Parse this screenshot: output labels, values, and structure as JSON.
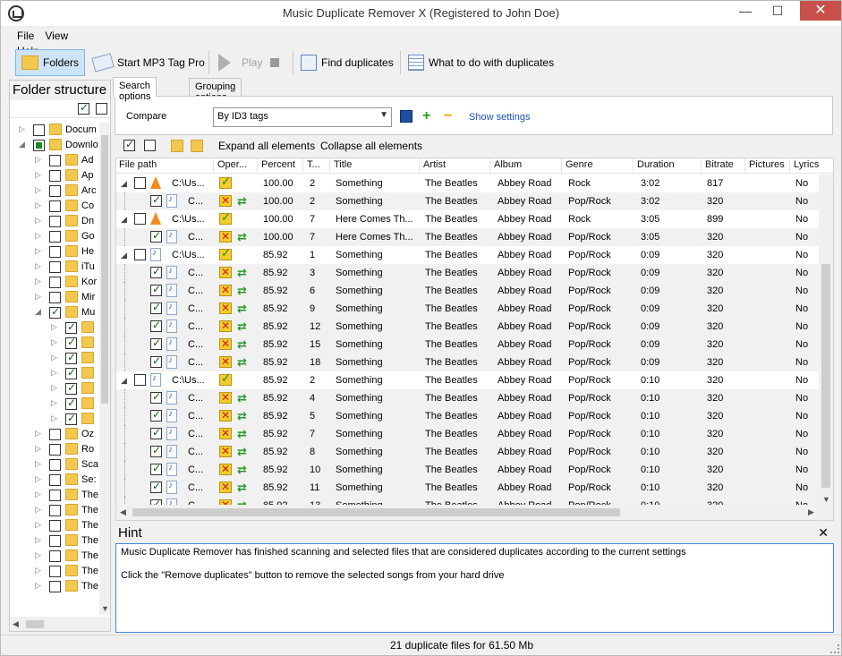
{
  "window": {
    "title": "Music Duplicate Remover X (Registered to John Doe)",
    "minimize": "—",
    "maximize": "☐",
    "close": "✕"
  },
  "menu": [
    "File",
    "View",
    "Help"
  ],
  "toolbar": {
    "folders": "Folders",
    "mp3tag": "Start MP3 Tag Pro",
    "play": "Play",
    "find": "Find duplicates",
    "what": "What to do with duplicates"
  },
  "left": {
    "title": "Folder structure",
    "tree": [
      {
        "label": "Docum",
        "level": 0,
        "arrow": "▷",
        "check": "off"
      },
      {
        "label": "Downlo",
        "level": 0,
        "arrow": "◢",
        "check": "partial"
      },
      {
        "label": "Ad",
        "level": 1,
        "arrow": "▷",
        "check": "off"
      },
      {
        "label": "Ap",
        "level": 1,
        "arrow": "▷",
        "check": "off"
      },
      {
        "label": "Arc",
        "level": 1,
        "arrow": "▷",
        "check": "off"
      },
      {
        "label": "Co",
        "level": 1,
        "arrow": "▷",
        "check": "off"
      },
      {
        "label": "Dn",
        "level": 1,
        "arrow": "▷",
        "check": "off"
      },
      {
        "label": "Go",
        "level": 1,
        "arrow": "▷",
        "check": "off"
      },
      {
        "label": "He",
        "level": 1,
        "arrow": "▷",
        "check": "off"
      },
      {
        "label": "iTu",
        "level": 1,
        "arrow": "▷",
        "check": "off"
      },
      {
        "label": "Kor",
        "level": 1,
        "arrow": "▷",
        "check": "off"
      },
      {
        "label": "Mir",
        "level": 1,
        "arrow": "▷",
        "check": "off"
      },
      {
        "label": "Mu",
        "level": 1,
        "arrow": "◢",
        "check": "on"
      },
      {
        "label": "",
        "level": 2,
        "arrow": "▷",
        "check": "on"
      },
      {
        "label": "",
        "level": 2,
        "arrow": "▷",
        "check": "on"
      },
      {
        "label": "",
        "level": 2,
        "arrow": "▷",
        "check": "on"
      },
      {
        "label": "",
        "level": 2,
        "arrow": "▷",
        "check": "on"
      },
      {
        "label": "",
        "level": 2,
        "arrow": "▷",
        "check": "on"
      },
      {
        "label": "",
        "level": 2,
        "arrow": "▷",
        "check": "on"
      },
      {
        "label": "",
        "level": 2,
        "arrow": "▷",
        "check": "on"
      },
      {
        "label": "Oz",
        "level": 1,
        "arrow": "▷",
        "check": "off"
      },
      {
        "label": "Ro",
        "level": 1,
        "arrow": "▷",
        "check": "off"
      },
      {
        "label": "Sca",
        "level": 1,
        "arrow": "▷",
        "check": "off"
      },
      {
        "label": "Se:",
        "level": 1,
        "arrow": "▷",
        "check": "off"
      },
      {
        "label": "The",
        "level": 1,
        "arrow": "▷",
        "check": "off"
      },
      {
        "label": "The",
        "level": 1,
        "arrow": "▷",
        "check": "off"
      },
      {
        "label": "The",
        "level": 1,
        "arrow": "▷",
        "check": "off"
      },
      {
        "label": "The",
        "level": 1,
        "arrow": "▷",
        "check": "off"
      },
      {
        "label": "The",
        "level": 1,
        "arrow": "▷",
        "check": "off"
      },
      {
        "label": "The",
        "level": 1,
        "arrow": "▷",
        "check": "off"
      },
      {
        "label": "The",
        "level": 1,
        "arrow": "▷",
        "check": "off"
      }
    ]
  },
  "tabs": [
    "Search options",
    "Grouping options"
  ],
  "search": {
    "compare_label": "Compare",
    "compare_value": "By ID3 tags",
    "show_settings": "Show settings"
  },
  "grid_toolbar": {
    "expand": "Expand all elements",
    "collapse": "Collapse all elements"
  },
  "columns": [
    "File path",
    "Oper...",
    "Percent",
    "T...",
    "Title",
    "Artist",
    "Album",
    "Genre",
    "Duration",
    "Bitrate",
    "Pictures",
    "Lyrics"
  ],
  "rows": [
    {
      "kind": "parent",
      "icon": "vlc",
      "path": "C:\\Us...",
      "op": "ok",
      "percent": "100.00",
      "track": "2",
      "title": "Something",
      "artist": "The Beatles",
      "album": "Abbey Road",
      "genre": "Rock",
      "duration": "3:02",
      "bitrate": "817",
      "lyrics": "No"
    },
    {
      "kind": "child",
      "icon": "file",
      "path": "C...",
      "op": "del",
      "percent": "100.00",
      "track": "2",
      "title": "Something",
      "artist": "The Beatles",
      "album": "Abbey Road",
      "genre": "Pop/Rock",
      "duration": "3:02",
      "bitrate": "320",
      "lyrics": "No"
    },
    {
      "kind": "parent",
      "icon": "vlc",
      "path": "C:\\Us...",
      "op": "ok",
      "percent": "100.00",
      "track": "7",
      "title": "Here Comes Th...",
      "artist": "The Beatles",
      "album": "Abbey Road",
      "genre": "Rock",
      "duration": "3:05",
      "bitrate": "899",
      "lyrics": "No"
    },
    {
      "kind": "child",
      "icon": "file",
      "path": "C...",
      "op": "del",
      "percent": "100.00",
      "track": "7",
      "title": "Here Comes Th...",
      "artist": "The Beatles",
      "album": "Abbey Road",
      "genre": "Pop/Rock",
      "duration": "3:05",
      "bitrate": "320",
      "lyrics": "No"
    },
    {
      "kind": "parent",
      "icon": "file",
      "path": "C:\\Us...",
      "op": "ok",
      "percent": "85.92",
      "track": "1",
      "title": "Something",
      "artist": "The Beatles",
      "album": "Abbey Road",
      "genre": "Pop/Rock",
      "duration": "0:09",
      "bitrate": "320",
      "lyrics": "No"
    },
    {
      "kind": "child",
      "icon": "file",
      "path": "C...",
      "op": "del",
      "percent": "85.92",
      "track": "3",
      "title": "Something",
      "artist": "The Beatles",
      "album": "Abbey Road",
      "genre": "Pop/Rock",
      "duration": "0:09",
      "bitrate": "320",
      "lyrics": "No"
    },
    {
      "kind": "child",
      "icon": "file",
      "path": "C...",
      "op": "del",
      "percent": "85.92",
      "track": "6",
      "title": "Something",
      "artist": "The Beatles",
      "album": "Abbey Road",
      "genre": "Pop/Rock",
      "duration": "0:09",
      "bitrate": "320",
      "lyrics": "No"
    },
    {
      "kind": "child",
      "icon": "file",
      "path": "C...",
      "op": "del",
      "percent": "85.92",
      "track": "9",
      "title": "Something",
      "artist": "The Beatles",
      "album": "Abbey Road",
      "genre": "Pop/Rock",
      "duration": "0:09",
      "bitrate": "320",
      "lyrics": "No"
    },
    {
      "kind": "child",
      "icon": "file",
      "path": "C...",
      "op": "del",
      "percent": "85.92",
      "track": "12",
      "title": "Something",
      "artist": "The Beatles",
      "album": "Abbey Road",
      "genre": "Pop/Rock",
      "duration": "0:09",
      "bitrate": "320",
      "lyrics": "No"
    },
    {
      "kind": "child",
      "icon": "file",
      "path": "C...",
      "op": "del",
      "percent": "85.92",
      "track": "15",
      "title": "Something",
      "artist": "The Beatles",
      "album": "Abbey Road",
      "genre": "Pop/Rock",
      "duration": "0:09",
      "bitrate": "320",
      "lyrics": "No"
    },
    {
      "kind": "child",
      "icon": "file",
      "path": "C...",
      "op": "del",
      "percent": "85.92",
      "track": "18",
      "title": "Something",
      "artist": "The Beatles",
      "album": "Abbey Road",
      "genre": "Pop/Rock",
      "duration": "0:09",
      "bitrate": "320",
      "lyrics": "No"
    },
    {
      "kind": "parent",
      "icon": "file",
      "path": "C:\\Us...",
      "op": "ok",
      "percent": "85.92",
      "track": "2",
      "title": "Something",
      "artist": "The Beatles",
      "album": "Abbey Road",
      "genre": "Pop/Rock",
      "duration": "0:10",
      "bitrate": "320",
      "lyrics": "No"
    },
    {
      "kind": "child",
      "icon": "file",
      "path": "C...",
      "op": "del",
      "percent": "85.92",
      "track": "4",
      "title": "Something",
      "artist": "The Beatles",
      "album": "Abbey Road",
      "genre": "Pop/Rock",
      "duration": "0:10",
      "bitrate": "320",
      "lyrics": "No"
    },
    {
      "kind": "child",
      "icon": "file",
      "path": "C...",
      "op": "del",
      "percent": "85.92",
      "track": "5",
      "title": "Something",
      "artist": "The Beatles",
      "album": "Abbey Road",
      "genre": "Pop/Rock",
      "duration": "0:10",
      "bitrate": "320",
      "lyrics": "No"
    },
    {
      "kind": "child",
      "icon": "file",
      "path": "C...",
      "op": "del",
      "percent": "85.92",
      "track": "7",
      "title": "Something",
      "artist": "The Beatles",
      "album": "Abbey Road",
      "genre": "Pop/Rock",
      "duration": "0:10",
      "bitrate": "320",
      "lyrics": "No"
    },
    {
      "kind": "child",
      "icon": "file",
      "path": "C...",
      "op": "del",
      "percent": "85.92",
      "track": "8",
      "title": "Something",
      "artist": "The Beatles",
      "album": "Abbey Road",
      "genre": "Pop/Rock",
      "duration": "0:10",
      "bitrate": "320",
      "lyrics": "No"
    },
    {
      "kind": "child",
      "icon": "file",
      "path": "C...",
      "op": "del",
      "percent": "85.92",
      "track": "10",
      "title": "Something",
      "artist": "The Beatles",
      "album": "Abbey Road",
      "genre": "Pop/Rock",
      "duration": "0:10",
      "bitrate": "320",
      "lyrics": "No"
    },
    {
      "kind": "child",
      "icon": "file",
      "path": "C...",
      "op": "del",
      "percent": "85.92",
      "track": "11",
      "title": "Something",
      "artist": "The Beatles",
      "album": "Abbey Road",
      "genre": "Pop/Rock",
      "duration": "0:10",
      "bitrate": "320",
      "lyrics": "No"
    },
    {
      "kind": "child",
      "icon": "file",
      "path": "C...",
      "op": "del",
      "percent": "85.92",
      "track": "13",
      "title": "Something",
      "artist": "The Beatles",
      "album": "Abbey Road",
      "genre": "Pop/Rock",
      "duration": "0:10",
      "bitrate": "320",
      "lyrics": "No"
    }
  ],
  "hint": {
    "title": "Hint",
    "close": "✕",
    "line1": "Music Duplicate Remover has finished scanning and selected files that are considered duplicates according to the current settings",
    "line2": "Click the \"Remove duplicates\" button to remove the selected songs from your hard drive"
  },
  "status": "21 duplicate files for 61.50 Mb"
}
